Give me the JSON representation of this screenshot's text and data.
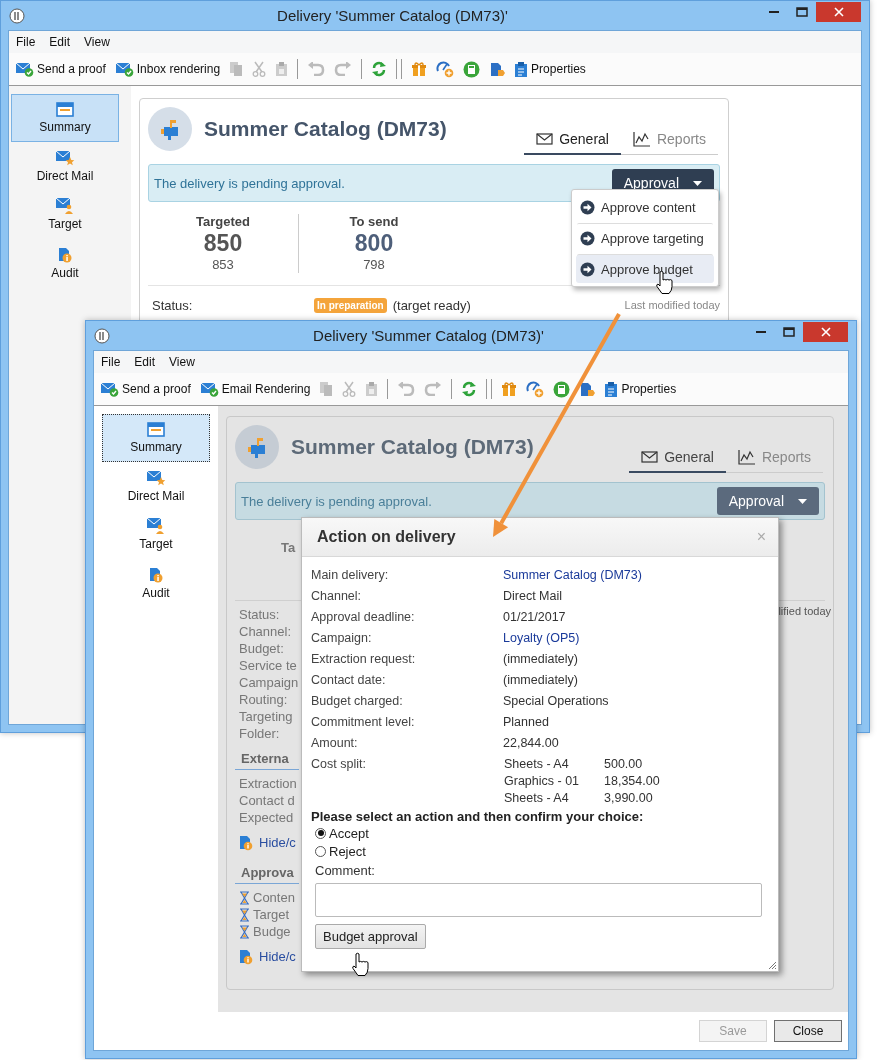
{
  "back_window": {
    "title": "Delivery 'Summer Catalog  (DM73)'",
    "menu": [
      "File",
      "Edit",
      "View"
    ],
    "toolbar": {
      "actions": [
        "Send a proof",
        "Inbox rendering"
      ],
      "properties": "Properties"
    },
    "sidebar": [
      {
        "label": "Summary",
        "selected": true
      },
      {
        "label": "Direct Mail",
        "selected": false
      },
      {
        "label": "Target",
        "selected": false
      },
      {
        "label": "Audit",
        "selected": false
      }
    ],
    "heading": "Summer Catalog (DM73)",
    "tabs": [
      {
        "label": "General",
        "selected": true
      },
      {
        "label": "Reports",
        "selected": false
      }
    ],
    "banner": {
      "message": "The delivery is pending approval.",
      "button": "Approval"
    },
    "approval_menu": [
      {
        "label": "Approve content",
        "selected": false
      },
      {
        "label": "Approve targeting",
        "selected": false
      },
      {
        "label": "Approve budget",
        "selected": true
      }
    ],
    "counts": [
      {
        "label": "Targeted",
        "value": "850",
        "detail": "853"
      },
      {
        "label": "To send",
        "value": "800",
        "detail": "798"
      }
    ],
    "status": {
      "label": "Status:",
      "badge": "In preparation",
      "note": "(target ready)",
      "modified": "Last modified today"
    }
  },
  "front_window": {
    "title": "Delivery 'Summer Catalog  (DM73)'",
    "menu": [
      "File",
      "Edit",
      "View"
    ],
    "toolbar": {
      "actions": [
        "Send a proof",
        "Email Rendering"
      ],
      "properties": "Properties"
    },
    "sidebar": [
      {
        "label": "Summary",
        "selected": true
      },
      {
        "label": "Direct Mail",
        "selected": false
      },
      {
        "label": "Target",
        "selected": false
      },
      {
        "label": "Audit",
        "selected": false
      }
    ],
    "heading": "Summer Catalog (DM73)",
    "tabs": [
      {
        "label": "General",
        "selected": true
      },
      {
        "label": "Reports",
        "selected": false
      }
    ],
    "banner": {
      "message": "The delivery is pending approval.",
      "button": "Approval"
    },
    "counts_cut": "Ta",
    "modified_cut": "lified today",
    "field_labels": [
      "Status:",
      "Channel:",
      "Budget:",
      "Service te",
      "Campaign",
      "Routing:",
      "Targeting",
      "Folder:"
    ],
    "sections": [
      {
        "heading": "Externa",
        "rows": [
          {
            "kind": "plain",
            "label": "Extraction"
          },
          {
            "kind": "plain",
            "label": "Contact d"
          },
          {
            "kind": "plain",
            "label": "Expected"
          }
        ],
        "link": "Hide/c"
      },
      {
        "heading": "Approva",
        "rows": [
          {
            "kind": "pending",
            "label": "Conten"
          },
          {
            "kind": "pending",
            "label": "Target"
          },
          {
            "kind": "pending",
            "label": "Budge"
          }
        ],
        "link": "Hide/c"
      }
    ],
    "dialog": {
      "title": "Action on delivery",
      "close": "×",
      "fields": [
        {
          "label": "Main delivery:",
          "kind": "link",
          "value": "Summer Catalog (DM73)"
        },
        {
          "label": "Channel:",
          "kind": "text",
          "value": "Direct Mail"
        },
        {
          "label": "Approval deadline:",
          "kind": "text",
          "value": "01/21/2017"
        },
        {
          "label": "Campaign:",
          "kind": "link",
          "value": "Loyalty (OP5)"
        },
        {
          "label": "Extraction request:",
          "kind": "text",
          "value": "(immediately)"
        },
        {
          "label": "Contact date:",
          "kind": "text",
          "value": "(immediately)"
        },
        {
          "label": "Budget charged:",
          "kind": "text",
          "value": "Special Operations"
        },
        {
          "label": "Commitment level:",
          "kind": "text",
          "value": "Planned"
        },
        {
          "label": "Amount:",
          "kind": "text",
          "value": "22,844.00"
        },
        {
          "label": "Cost split:",
          "kind": "split",
          "lines": [
            {
              "item": "Sheets - A4",
              "amount": "500.00"
            },
            {
              "item": "Graphics - 01",
              "amount": "18,354.00"
            },
            {
              "item": "Sheets - A4",
              "amount": "3,990.00"
            }
          ]
        }
      ],
      "prompt": "Please select an action and then confirm your choice:",
      "options": [
        {
          "label": "Accept",
          "selected": true
        },
        {
          "label": "Reject",
          "selected": false
        }
      ],
      "comment_label": "Comment:",
      "button": "Budget approval"
    },
    "footer": [
      {
        "label": "Save",
        "disabled": true
      },
      {
        "label": "Close",
        "disabled": false
      }
    ]
  }
}
